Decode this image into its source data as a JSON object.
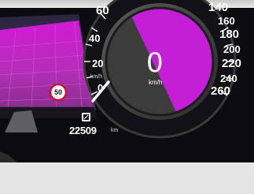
{
  "speedometer": {
    "scale_left": [
      "60",
      "40",
      "20",
      "0"
    ],
    "scale_right": [
      "140",
      "160",
      "180",
      "200",
      "220",
      "240",
      "260"
    ],
    "scale_unit": "km/h",
    "digital_speed": "0",
    "digital_unit": "km/h"
  },
  "speed_limit_sign": {
    "value": "50"
  },
  "odometer": {
    "value": "22509",
    "unit": "km"
  },
  "colors": {
    "accent_magenta": "#c21fd6",
    "screen_black": "#0b0b10",
    "needle_white": "#ffffff"
  },
  "icons": [
    "speed-limit-sign-icon",
    "odometer-icon",
    "needle-icon"
  ]
}
